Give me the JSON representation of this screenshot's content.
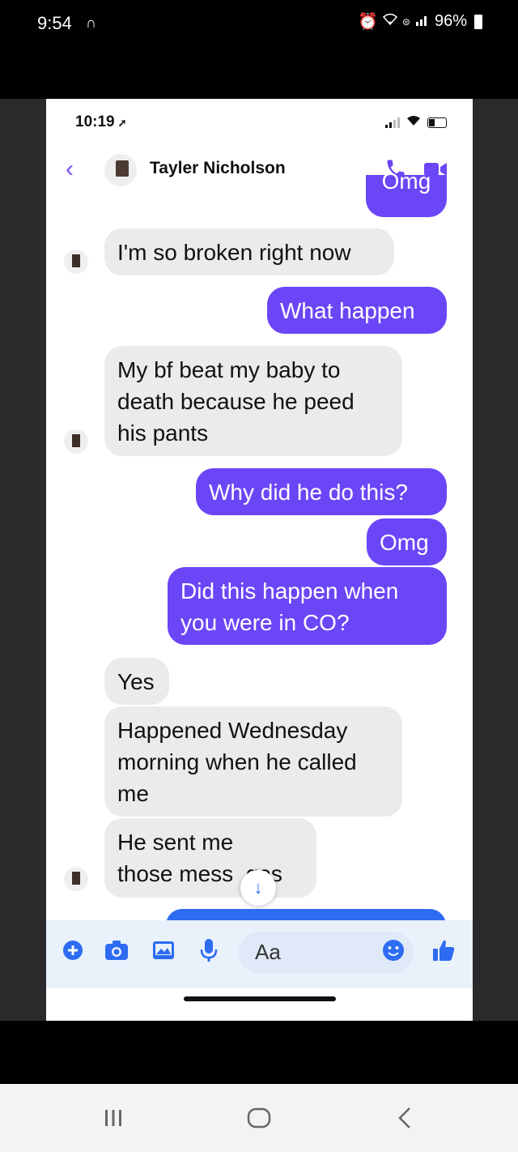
{
  "os_status": {
    "time": "9:54",
    "battery": "96%"
  },
  "ios_status": {
    "time": "10:19"
  },
  "header": {
    "contact_name": "Tayler Nicholson"
  },
  "messages": [
    {
      "dir": "out",
      "text": "Omg"
    },
    {
      "dir": "in",
      "text": "I'm so broken right now"
    },
    {
      "dir": "out",
      "text": "What happen"
    },
    {
      "dir": "in",
      "lines": [
        "My bf beat my baby to",
        "death because he peed",
        "his pants"
      ]
    },
    {
      "dir": "out",
      "text": "Why did he do this?"
    },
    {
      "dir": "out",
      "text": "Omg"
    },
    {
      "dir": "out",
      "lines": [
        "Did this happen when",
        "you were in CO?"
      ]
    },
    {
      "dir": "in",
      "text": "Yes"
    },
    {
      "dir": "in",
      "lines": [
        "Happened Wednesday",
        "morning when he called",
        "me"
      ]
    },
    {
      "dir": "in",
      "lines": [
        "He sent me",
        "those mess  ges"
      ]
    }
  ],
  "composer": {
    "placeholder": "Aa"
  },
  "colors": {
    "outgoing": "#6b46f6",
    "incoming": "#ebebeb",
    "accent": "#2d6cf2"
  }
}
